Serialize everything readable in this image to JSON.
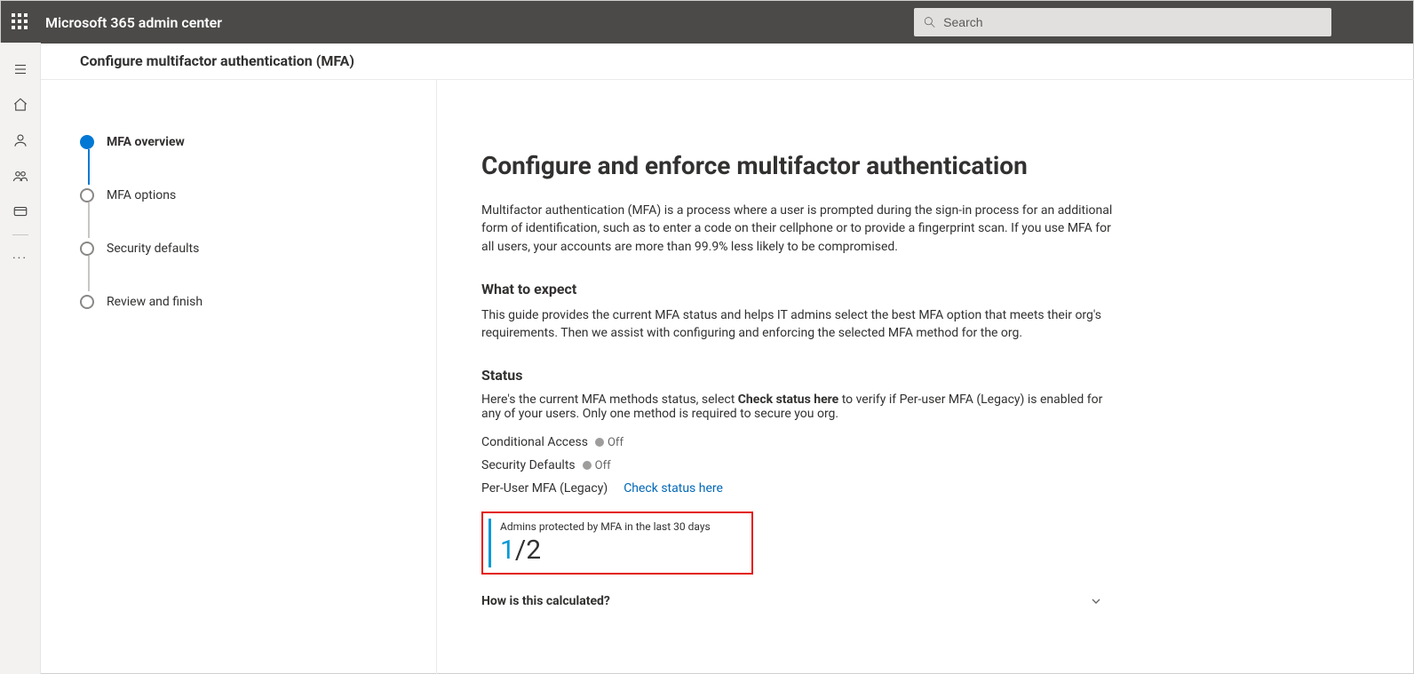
{
  "topbar": {
    "title": "Microsoft 365 admin center",
    "search_placeholder": "Search"
  },
  "page": {
    "header": "Configure multifactor authentication (MFA)"
  },
  "steps": [
    {
      "label": "MFA overview",
      "active": true
    },
    {
      "label": "MFA options",
      "active": false
    },
    {
      "label": "Security defaults",
      "active": false
    },
    {
      "label": "Review and finish",
      "active": false
    }
  ],
  "main": {
    "title": "Configure and enforce multifactor authentication",
    "intro": "Multifactor authentication (MFA) is a process where a user is prompted during the sign-in process for an additional form of identification, such as to enter a code on their cellphone or to provide a fingerprint scan. If you use MFA for all users, your accounts are more than 99.9% less likely to be compromised.",
    "expect_heading": "What to expect",
    "expect_body": "This guide provides the current MFA status and helps IT admins select the best MFA option that meets their org's requirements. Then we assist with configuring and enforcing the selected MFA method for the org.",
    "status_heading": "Status",
    "status_intro_pre": "Here's the current MFA methods status, select ",
    "status_intro_bold": "Check status here",
    "status_intro_post": " to verify if Per-user MFA (Legacy) is enabled for any of your users. Only one method is required to secure you org.",
    "status": {
      "ca_label": "Conditional Access",
      "ca_state": "Off",
      "sd_label": "Security Defaults",
      "sd_state": "Off",
      "pu_label": "Per-User MFA (Legacy)",
      "pu_link": "Check status here"
    },
    "metric": {
      "caption": "Admins protected by MFA in the last 30 days",
      "numerator": "1",
      "sep": "/",
      "denominator": "2"
    },
    "accordion_label": "How is this calculated?"
  }
}
